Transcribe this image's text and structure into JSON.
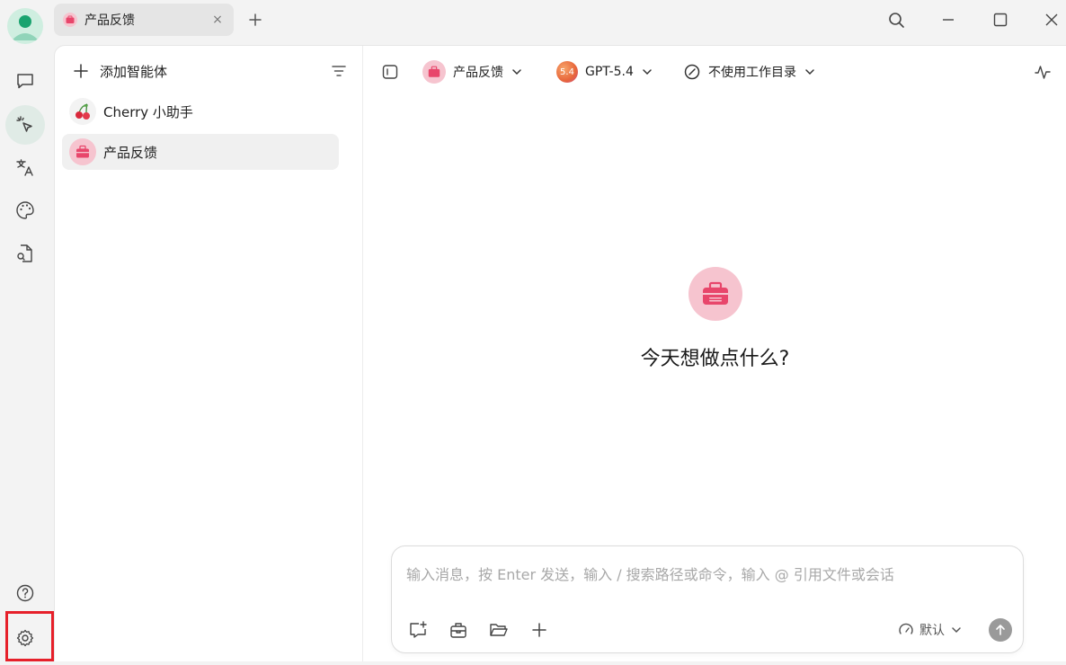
{
  "window": {
    "tab_label": "产品反馈",
    "tab_close": "×"
  },
  "icons": {
    "avatar": "user-avatar",
    "rail": [
      "chat-icon",
      "agent-cursor-icon",
      "translate-icon",
      "palette-icon",
      "document-search-icon",
      "help-icon",
      "settings-icon"
    ],
    "toolbar": [
      "sidebar-toggle-icon",
      "chevron-down-icon",
      "timeline-icon"
    ]
  },
  "agents_panel": {
    "add_label": "添加智能体",
    "items": [
      {
        "label": "Cherry 小助手"
      },
      {
        "label": "产品反馈"
      }
    ]
  },
  "chat": {
    "assistant_name": "产品反馈",
    "model_badge": "5.4",
    "model_name": "GPT-5.4",
    "workdir_label": "不使用工作目录",
    "welcome": "今天想做点什么?",
    "input_placeholder": "输入消息，按 Enter 发送，输入 / 搜索路径或命令，输入 @ 引用文件或会话",
    "mode_label": "默认"
  },
  "colors": {
    "accent_green": "#1aa36f",
    "briefcase_pink": "#e8466b",
    "highlight_red": "#e6202a"
  }
}
